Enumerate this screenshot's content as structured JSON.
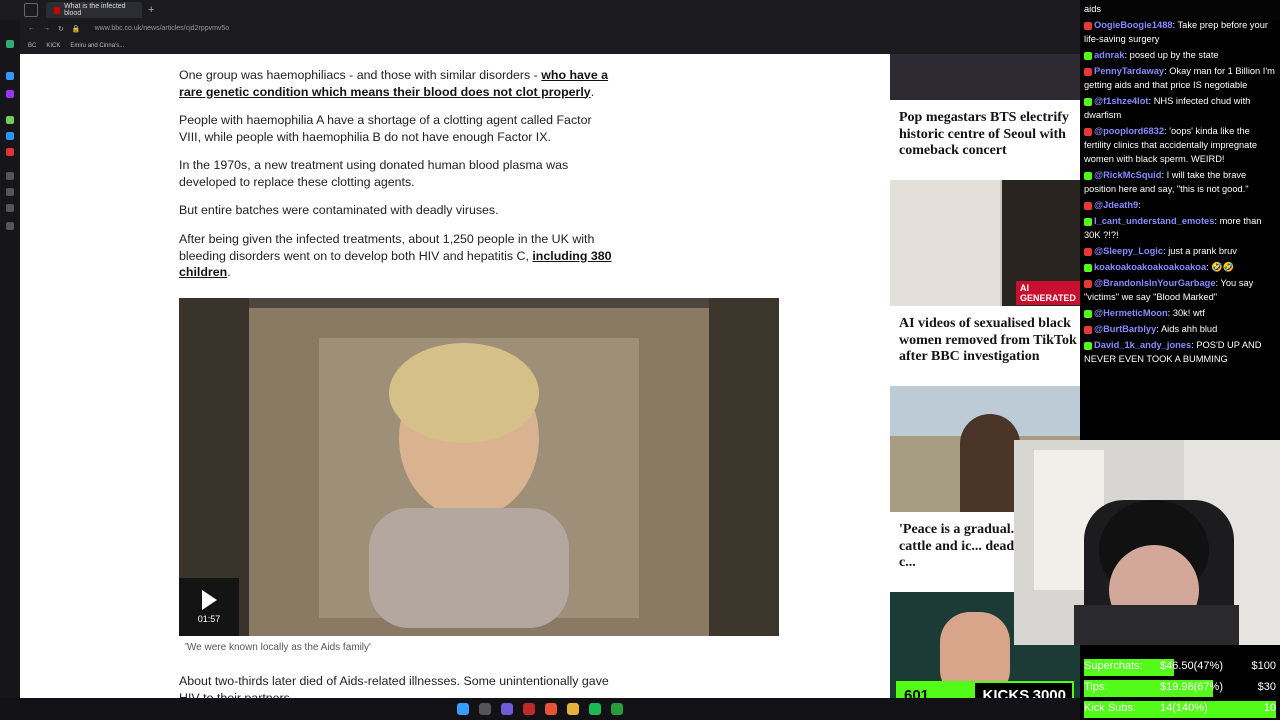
{
  "browser": {
    "tab_title": "What is the infected blood",
    "url": "www.bbc.co.uk/news/articles/cjd2rppvmv5o",
    "bookmarks": [
      "BC",
      "KICK",
      "Emiru and Cinna's..."
    ]
  },
  "article": {
    "p1_text": "One group was haemophiliacs - and those with similar disorders - ",
    "p1_link": "who have a rare genetic condition which means their blood does not clot properly",
    "p2": "People with haemophilia A have a shortage of a clotting agent called Factor VIII, while people with haemophilia B do not have enough Factor IX.",
    "p3": "In the 1970s, a new treatment using donated human blood plasma was developed to replace these clotting agents.",
    "p4": "But entire batches were contaminated with deadly viruses.",
    "p5_text": "After being given the infected treatments, about 1,250 people in the UK with bleeding disorders went on to develop both HIV and hepatitis C, ",
    "p5_link": "including 380 children",
    "video_duration": "01:57",
    "video_caption": "'We were known locally as the Aids family'",
    "p6": "About two-thirds later died of Aids-related illnesses. Some unintentionally gave HIV to their partners."
  },
  "sidebar_cards": [
    {
      "title": "Pop megastars BTS electrify historic centre of Seoul with comeback concert"
    },
    {
      "title": "AI videos of sexualised black women removed from TikTok after BBC investigation",
      "badge": "AI GENERATED"
    },
    {
      "title": "'Peace is a gradual... land, cattle and ic... deadly Nigerian c..."
    }
  ],
  "chat": [
    {
      "user": "",
      "text": "aids",
      "color": "#ffffff"
    },
    {
      "user": "OogieBoogie1488",
      "text": "Take prep before your life-saving surgery",
      "color": "#8a8aff"
    },
    {
      "user": "adnrak",
      "text": "posed up by the state",
      "color": "#8a8aff"
    },
    {
      "user": "PennyTardaway",
      "text": "Okay man for 1 Billion I'm getting aids and that price IS negotiable",
      "color": "#8a8aff"
    },
    {
      "user": "@f1shze4lot",
      "text": "NHS infected chud with dwarfism",
      "color": "#8a8aff"
    },
    {
      "user": "@pooplord6832",
      "text": "'oops' kinda like the fertility clinics that accidentally impregnate women with black sperm. WEIRD!",
      "color": "#8a8aff"
    },
    {
      "user": "@RickMcSquid",
      "text": "I will take the brave position here and say, \"this is not good.\"",
      "color": "#8a8aff"
    },
    {
      "user": "@Jdeath9",
      "text": "",
      "color": "#8a8aff"
    },
    {
      "user": "I_cant_understand_emotes",
      "text": "more than 30K ?!?!",
      "color": "#8a8aff"
    },
    {
      "user": "@Sleepy_Logic",
      "text": "just a prank bruv",
      "color": "#8a8aff"
    },
    {
      "user": "koakoakoakoakoakoakoa",
      "text": "🤣🤣",
      "color": "#8a8aff"
    },
    {
      "user": "@BrandonIsInYourGarbage",
      "text": "You say \"victims\" we say \"Blood Marked\"",
      "color": "#8a8aff"
    },
    {
      "user": "@HermeticMoon",
      "text": "30k! wtf",
      "color": "#8a8aff"
    },
    {
      "user": "@BurtBarblyy",
      "text": "Aids ahh blud",
      "color": "#8a8aff"
    },
    {
      "user": "David_1k_andy_jones",
      "text": "POS'D UP AND NEVER EVEN TOOK A BUMMING",
      "color": "#8a8aff"
    }
  ],
  "stats": [
    {
      "label": "Superchats:",
      "value": "$46.50(47%)",
      "goal": "$100",
      "fraction": 0.47
    },
    {
      "label": "Tips:",
      "value": "$19.98(67%)",
      "goal": "$30",
      "fraction": 0.67
    },
    {
      "label": "Kick Subs:",
      "value": "14(140%)",
      "goal": "10",
      "fraction": 1.0
    }
  ],
  "kicks": {
    "count": "601",
    "label": "KICKS",
    "goal": "3000"
  },
  "colors": {
    "kick_green": "#53fc18",
    "bbc_red": "#b80000"
  }
}
